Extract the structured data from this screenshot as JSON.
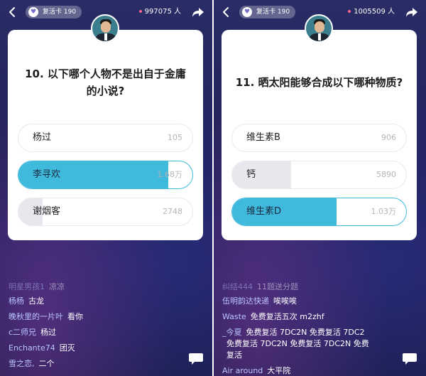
{
  "panels": [
    {
      "revive_card": "复活卡 190",
      "viewer_count": "997075 人",
      "question": "10. 以下哪个人物不是出自于金庸的小说?",
      "options": [
        {
          "label": "杨过",
          "count": "105",
          "fill": 0.0,
          "selected": false
        },
        {
          "label": "李寻欢",
          "count": "1.68万",
          "fill": 0.86,
          "selected": true
        },
        {
          "label": "谢烟客",
          "count": "2748",
          "fill": 0.14,
          "selected": false
        }
      ],
      "chat": [
        {
          "user": "明星男孩1",
          "msg": "凉凉",
          "faded": true
        },
        {
          "user": "杨杨",
          "msg": "古龙",
          "faded": false
        },
        {
          "user": "晚秋里的一片叶",
          "msg": "看你",
          "faded": false
        },
        {
          "user": "c二师兄",
          "msg": "杨过",
          "faded": false
        },
        {
          "user": "Enchante74",
          "msg": "团灭",
          "faded": false
        },
        {
          "user": "雪之恋,",
          "msg": "二个",
          "faded": false
        }
      ]
    },
    {
      "revive_card": "复活卡 190",
      "viewer_count": "1005509 人",
      "question": "11. 晒太阳能够合成以下哪种物质?",
      "options": [
        {
          "label": "维生素B",
          "count": "906",
          "fill": 0.0,
          "selected": false
        },
        {
          "label": "钙",
          "count": "5890",
          "fill": 0.34,
          "selected": false
        },
        {
          "label": "维生素D",
          "count": "1.03万",
          "fill": 0.6,
          "selected": true
        }
      ],
      "chat": [
        {
          "user": "纠结444",
          "msg": "11题送分题",
          "faded": true
        },
        {
          "user": "伍明韵达快递",
          "msg": "唉唉唉",
          "faded": false
        },
        {
          "user": "Waste",
          "msg": "免费复活五次 m2zhf",
          "faded": false
        },
        {
          "user": "_今夏",
          "msg": "免费复活 7DC2N 免费复活 7DC2",
          "faded": false
        },
        {
          "user": "",
          "msg": "免费复活 7DC2N 免费复活 7DC2N 免费",
          "faded": false
        },
        {
          "user": "",
          "msg": "复活",
          "faded": false
        },
        {
          "user": "Air around",
          "msg": "大平院",
          "faded": false
        }
      ]
    }
  ],
  "colors": {
    "accent": "#3fb9dc",
    "bar_gray": "#e6e8ed",
    "bg_dark": "#1f2155"
  },
  "icons": [
    "back-icon",
    "heart-icon",
    "share-icon",
    "comment-icon",
    "avatar"
  ]
}
